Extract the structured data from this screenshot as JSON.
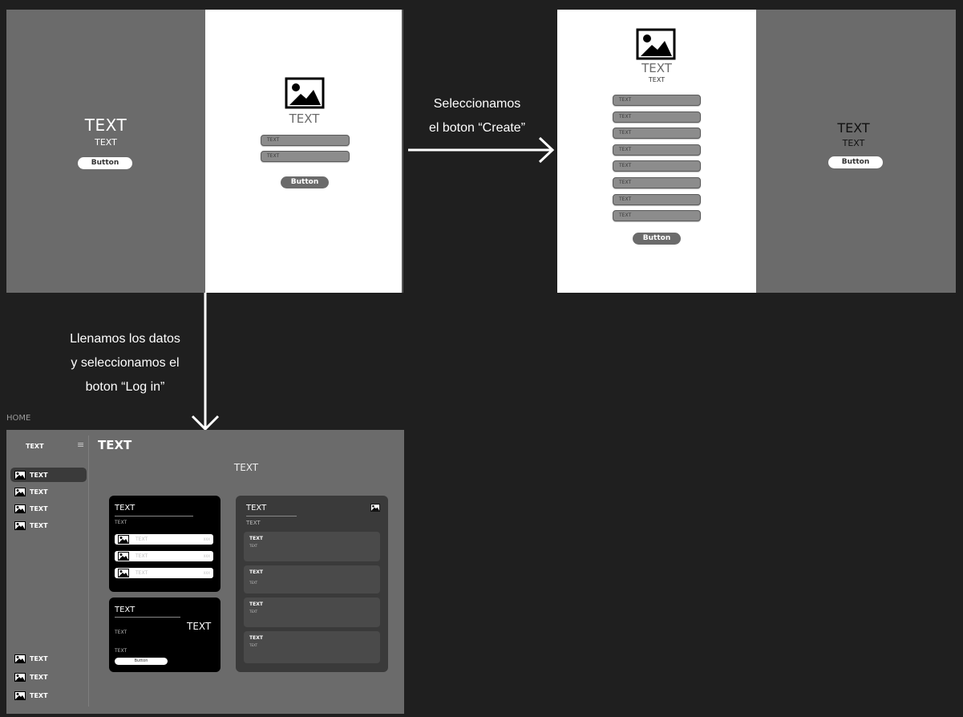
{
  "login_screen": {
    "left": {
      "title": "TEXT",
      "subtitle": "TEXT",
      "button": "Button"
    },
    "right": {
      "title": "TEXT",
      "fields": [
        "TEXT",
        "TEXT"
      ],
      "button": "Button"
    }
  },
  "create_screen": {
    "left": {
      "title": "TEXT",
      "subtitle": "TEXT",
      "fields": [
        "TEXT",
        "TEXT",
        "TEXT",
        "TEXT",
        "TEXT",
        "TEXT",
        "TEXT",
        "TEXT"
      ],
      "button": "Button"
    },
    "right": {
      "title": "TEXT",
      "subtitle": "TEXT",
      "button": "Button"
    }
  },
  "captions": {
    "create_line1": "Seleccionamos",
    "create_line2": "el boton “Create”",
    "login_line1": "Llenamos los datos",
    "login_line2": "y seleccionamos el",
    "login_line3": "boton “Log in”"
  },
  "home": {
    "label": "HOME",
    "sidebar": {
      "title": "TEXT",
      "items": [
        "TEXT",
        "TEXT",
        "TEXT",
        "TEXT"
      ],
      "bottom_items": [
        "TEXT",
        "TEXT",
        "TEXT"
      ]
    },
    "main_title": "TEXT",
    "center_text": "TEXT",
    "card1": {
      "title": "TEXT",
      "subtitle": "TEXT",
      "rows": [
        {
          "label": "TEXT",
          "value": "XXX"
        },
        {
          "label": "TEXT",
          "value": "XXX"
        },
        {
          "label": "TEXT",
          "value": "XXX"
        }
      ]
    },
    "card2": {
      "title": "TEXT",
      "big_text": "TEXT",
      "line1": "TEXT",
      "line2": "TEXT",
      "button": "Button"
    },
    "card3": {
      "title": "TEXT",
      "subtitle": "TEXT",
      "panels": [
        {
          "title": "TEXT",
          "text": "TEXT"
        },
        {
          "title": "TEXT",
          "text": "TEXT"
        },
        {
          "title": "TEXT",
          "text": "TEXT"
        },
        {
          "title": "TEXT",
          "text": "TEXT"
        }
      ]
    }
  }
}
